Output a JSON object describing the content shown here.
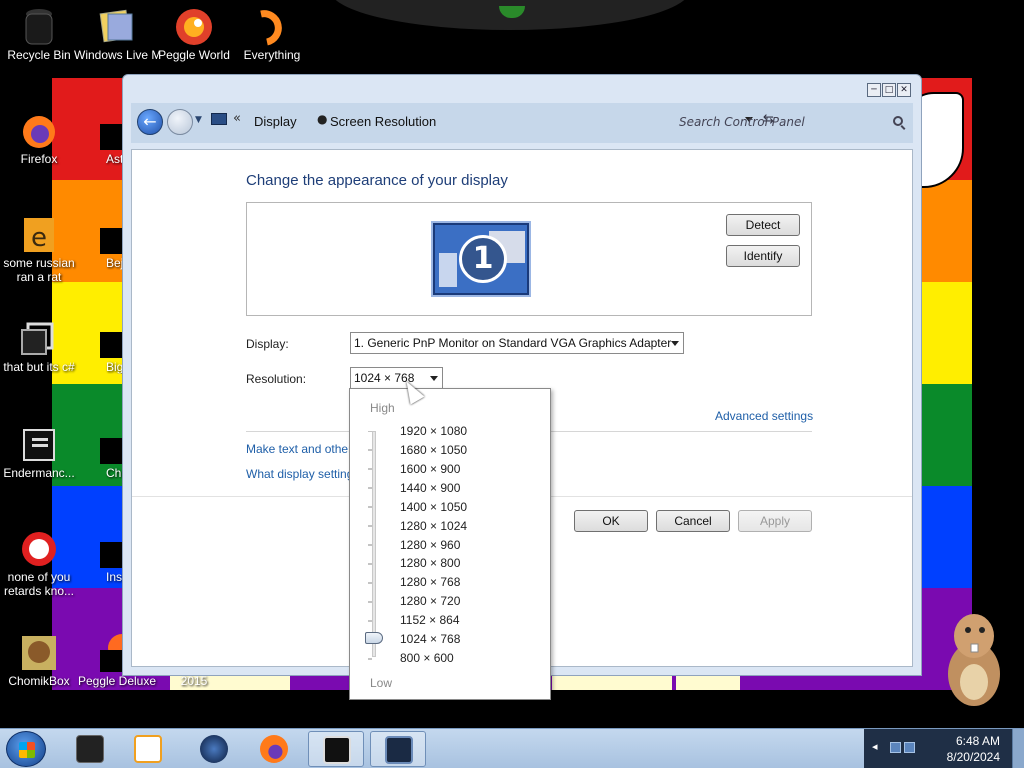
{
  "desktop": {
    "icons": [
      {
        "label": "Recycle Bin",
        "icon": "recycle-bin-icon"
      },
      {
        "label": "Windows Live Ma",
        "icon": "windows-live-icon"
      },
      {
        "label": "Peggle World",
        "icon": "peggle-icon"
      },
      {
        "label": "Everything",
        "icon": "everything-search-icon"
      },
      {
        "label": "Firefox",
        "icon": "firefox-icon"
      },
      {
        "label": "Astro Delu",
        "icon": "game-icon"
      },
      {
        "label": "some russian ran a rat",
        "icon": "file-icon"
      },
      {
        "label": "Bejew Delu",
        "icon": "game-icon"
      },
      {
        "label": "that but its c#",
        "icon": "shortcut-icon"
      },
      {
        "label": "Big Mo Delu",
        "icon": "game-icon"
      },
      {
        "label": "Endermanc...",
        "icon": "console-icon"
      },
      {
        "label": "Chuz Delu",
        "icon": "game-icon"
      },
      {
        "label": "none of you retards kno...",
        "icon": "app-icon"
      },
      {
        "label": "Insaniq Delu",
        "icon": "game-icon"
      },
      {
        "label": "ChomikBox",
        "icon": "chomikbox-icon"
      },
      {
        "label": "Peggle Deluxe",
        "icon": "peggle-icon"
      },
      {
        "label": "Visual Studio 2015",
        "icon": "visual-studio-icon"
      }
    ]
  },
  "window": {
    "controls": {
      "minimize": "─",
      "maximize": "□",
      "close": "✕"
    },
    "address": {
      "sep": "«",
      "crumb1": "Display",
      "crumb2": "Screen Resolution",
      "search_placeholder": "Search Control Panel"
    },
    "heading": "Change the appearance of your display",
    "monitor_number": "1",
    "buttons": {
      "detect": "Detect",
      "identify": "Identify",
      "ok": "OK",
      "cancel": "Cancel",
      "apply": "Apply"
    },
    "display_label": "Display:",
    "display_value": "1. Generic PnP Monitor on Standard VGA Graphics Adapter",
    "resolution_label": "Resolution:",
    "resolution_value": "1024 × 768",
    "advanced_link": "Advanced settings",
    "link1": "Make text and other",
    "link2": "What display setting"
  },
  "resolution_dropdown": {
    "high": "High",
    "low": "Low",
    "selected": "1024 × 768",
    "options": [
      "1920 × 1080",
      "1680 × 1050",
      "1600 × 900",
      "1440 × 900",
      "1400 × 1050",
      "1280 × 1024",
      "1280 × 960",
      "1280 × 800",
      "1280 × 768",
      "1280 × 720",
      "1152 × 864",
      "1024 × 768",
      "800 × 600"
    ]
  },
  "taskbar": {
    "time": "6:48 AM",
    "date": "8/20/2024",
    "items": [
      "app-icon",
      "media-player-icon",
      "globe-icon",
      "firefox-icon",
      "console-icon",
      "display-settings-icon"
    ]
  }
}
